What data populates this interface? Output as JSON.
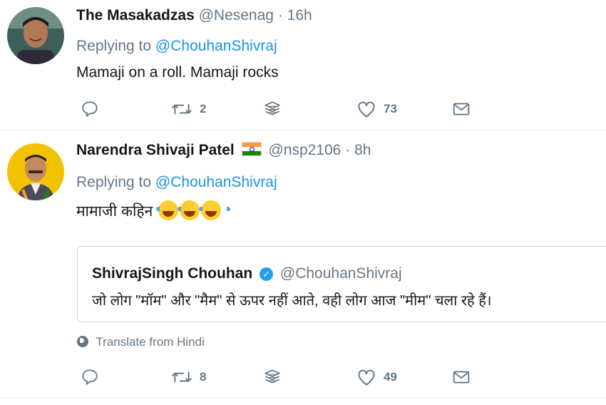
{
  "tweets": [
    {
      "name": "The Masakadzas",
      "handle": "@Nesenag",
      "separator": "·",
      "time": "16h",
      "replying_prefix": "Replying to",
      "replying_mention": "@ChouhanShivraj",
      "text": "Mamaji on a roll. Mamaji rocks",
      "retweets": "2",
      "likes": "73",
      "icons": [
        "reply-icon",
        "retweet-icon",
        "stack-icon",
        "heart-icon",
        "envelope-icon"
      ]
    },
    {
      "name": "Narendra Shivaji Patel",
      "handle": "@nsp2106",
      "separator": "·",
      "time": "8h",
      "replying_prefix": "Replying to",
      "replying_mention": "@ChouhanShivraj",
      "text": "मामाजी कहिन",
      "emoji_count": 3,
      "quote": {
        "name": "ShivrajSingh Chouhan",
        "handle": "@ChouhanShivraj",
        "text": "जो लोग \"मॉम\" और \"मैम\" से ऊपर नहीं आते, वही लोग आज \"मीम\" चला रहे हैं।"
      },
      "translate_label": "Translate from Hindi",
      "retweets": "8",
      "likes": "49",
      "icons": [
        "reply-icon",
        "retweet-icon",
        "stack-icon",
        "heart-icon",
        "envelope-icon"
      ]
    }
  ],
  "colors": {
    "link": "#1b95e0",
    "muted": "#657786",
    "text": "#14171a",
    "border": "#e6ecf0",
    "verified": "#1da1f2"
  }
}
